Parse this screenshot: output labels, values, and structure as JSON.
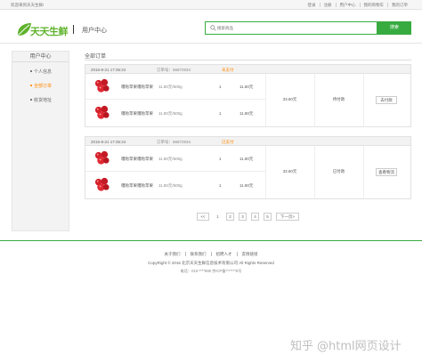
{
  "topbar": {
    "welcome": "欢迎来到天天生鲜!",
    "links": [
      "登录",
      "注册",
      "用户中心",
      "我的购物车",
      "我的订单"
    ]
  },
  "header": {
    "brand": "天天生鲜",
    "page_title": "用户中心",
    "search_placeholder": "搜索商品",
    "search_button": "搜索"
  },
  "sidebar": {
    "title": "用户中心",
    "items": [
      {
        "label": "个人信息",
        "active": false
      },
      {
        "label": "全部订单",
        "active": true
      },
      {
        "label": "收货地址",
        "active": false
      }
    ]
  },
  "main": {
    "title": "全部订单",
    "orders": [
      {
        "date": "2016-8-21 17:36:24",
        "number": "订单号：56872934",
        "status": "未支付",
        "goods": [
          {
            "name": "嘎啦苹果嘎啦苹果",
            "price": "11.80元/500g",
            "qty": "1",
            "subtotal": "11.80元"
          },
          {
            "name": "嘎啦苹果嘎啦苹果",
            "price": "11.80元/500g",
            "qty": "1",
            "subtotal": "11.80元"
          }
        ],
        "total": "33.60元",
        "pay_state": "待付款",
        "action": "去付款"
      },
      {
        "date": "2016-8-21 17:36:24",
        "number": "订单号：56872934",
        "status": "已支付",
        "goods": [
          {
            "name": "嘎啦苹果嘎啦苹果",
            "price": "11.80元/500g",
            "qty": "1",
            "subtotal": "11.80元"
          },
          {
            "name": "嘎啦苹果嘎啦苹果",
            "price": "11.80元/500g",
            "qty": "1",
            "subtotal": "11.80元"
          }
        ],
        "total": "33.60元",
        "pay_state": "已付款",
        "action": "查看物流"
      }
    ],
    "pager": {
      "prev": "<<",
      "pages": [
        "1",
        "2",
        "3",
        "4",
        "5"
      ],
      "current": "1",
      "next": "下一页>"
    }
  },
  "footer": {
    "links": [
      "关于我们",
      "联系我们",
      "招聘人才",
      "友情链接"
    ],
    "copyright": "CopyRight © 2016 北京天天生鲜信息技术有限公司 All Rights Reserved",
    "phone": "电话：010-****888    京ICP备*******8号"
  },
  "watermark": {
    "text1": "知乎",
    "text2": "@html网页设计"
  },
  "colors": {
    "brand_green": "#37ab40",
    "accent_orange": "#ff8800"
  }
}
